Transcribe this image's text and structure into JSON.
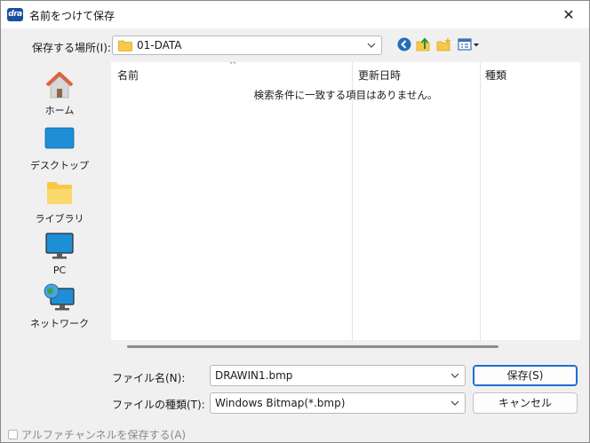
{
  "window": {
    "app_icon_text": "dra",
    "title": "名前をつけて保存",
    "close_glyph": "✕"
  },
  "location": {
    "label": "保存する場所(I):",
    "value": "01-DATA"
  },
  "toolbar": {
    "icons": [
      "back-icon",
      "up-folder-icon",
      "new-folder-icon",
      "view-menu-icon"
    ]
  },
  "sidebar": {
    "items": [
      {
        "label": "ホーム",
        "icon": "home-icon"
      },
      {
        "label": "デスクトップ",
        "icon": "desktop-icon"
      },
      {
        "label": "ライブラリ",
        "icon": "library-icon"
      },
      {
        "label": "PC",
        "icon": "pc-icon"
      },
      {
        "label": "ネットワーク",
        "icon": "network-icon"
      }
    ]
  },
  "filelist": {
    "columns": [
      "名前",
      "更新日時",
      "種類"
    ],
    "sort_indicator": "^",
    "empty_message": "検索条件に一致する項目はありません。"
  },
  "filename": {
    "label": "ファイル名(N):",
    "value": "DRAWIN1.bmp"
  },
  "filetype": {
    "label": "ファイルの種類(T):",
    "value": "Windows Bitmap(*.bmp)"
  },
  "buttons": {
    "save": "保存(S)",
    "cancel": "キャンセル"
  },
  "alpha_option": {
    "label": "アルファチャンネルを保存する(A)"
  },
  "colors": {
    "accent": "#1a6fd1",
    "folder": "#f7c948"
  }
}
